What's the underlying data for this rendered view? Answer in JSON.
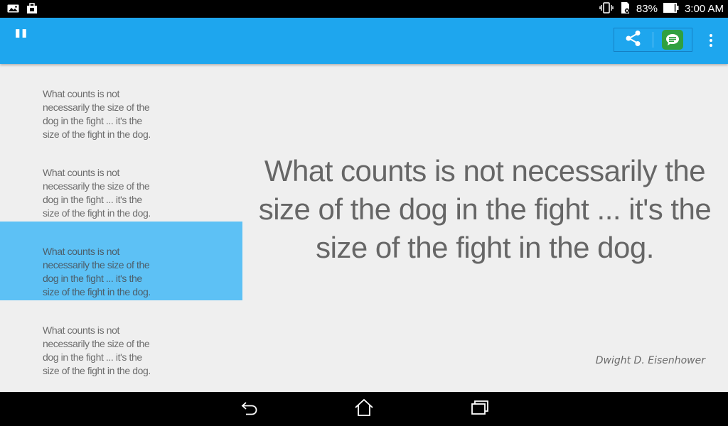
{
  "status_bar": {
    "left_icons": [
      "gallery-notification-icon",
      "shopping-bag-notification-icon"
    ],
    "right_icons": [
      "vibrate-icon",
      "sd-card-icon",
      "battery-icon"
    ],
    "battery": "83%",
    "time": "3:00 AM"
  },
  "app_bar": {
    "logo": "\"",
    "actions": [
      "share-icon",
      "chat-icon",
      "overflow-menu-icon"
    ],
    "color": "#1ea6ee"
  },
  "quotes": {
    "items": [
      {
        "text": "What counts is not necessarily the size of the dog in the fight ... it's the size of the fight in the dog."
      },
      {
        "text": "What counts is not necessarily the size of the dog in the fight ... it's the size of the fight in the dog."
      },
      {
        "text": "What counts is not necessarily the size of the dog in the fight ... it's the size of the fight in the dog.",
        "selected": true
      },
      {
        "text": "What counts is not necessarily the size of the dog in the fight ... it's the size of the fight in the dog."
      }
    ],
    "selected_color": "#5dc1f5"
  },
  "detail": {
    "quote": "What counts is not necessarily the size of the dog in the fight ... it's the size of the fight in the dog.",
    "author": "Dwight D. Eisenhower"
  },
  "nav_bar": {
    "buttons": [
      "back-icon",
      "home-icon",
      "recent-apps-icon"
    ]
  }
}
